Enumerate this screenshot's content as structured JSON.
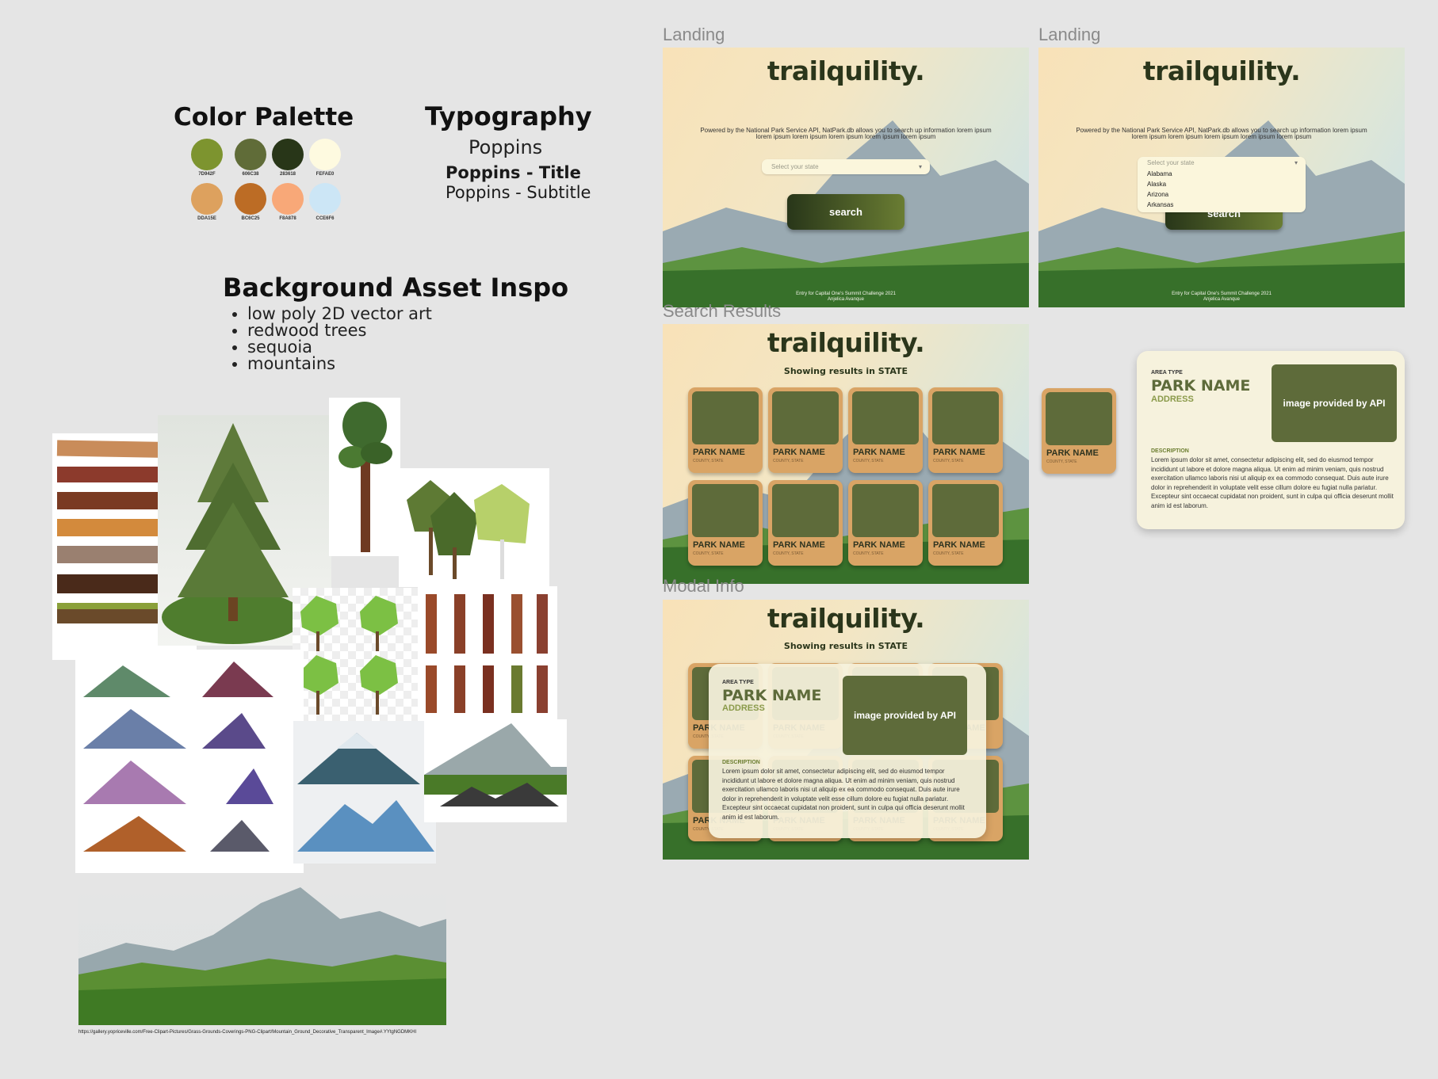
{
  "palette": {
    "title": "Color Palette",
    "colors": [
      {
        "hex": "#7D942F",
        "label": "7D942F"
      },
      {
        "hex": "#606C38",
        "label": "606C38"
      },
      {
        "hex": "#283618",
        "label": "283618"
      },
      {
        "hex": "#FEFAE0",
        "label": "FEFAE0"
      },
      {
        "hex": "#DDA15E",
        "label": "DDA15E"
      },
      {
        "hex": "#BC6C25",
        "label": "BC6C25"
      },
      {
        "hex": "#F8A878",
        "label": "F8A878"
      },
      {
        "hex": "#CCE6F6",
        "label": "CCE6F6"
      }
    ]
  },
  "typography": {
    "title": "Typography",
    "font": "Poppins",
    "sample_title": "Poppins - Title",
    "sample_subtitle": "Poppins - Subtitle"
  },
  "inspo": {
    "title": "Background Asset Inspo",
    "bullets": [
      "low poly 2D vector art",
      "redwood trees",
      "sequoia",
      "mountains"
    ],
    "source_url": "https://gallery.yopriceville.com/Free-Clipart-Pictures/Grass-Grounds-Coverings-PNG-Clipart/Mountain_Ground_Decorative_Transparent_Image#.YYtgNGDMKHI"
  },
  "frames": {
    "landing1_label": "Landing",
    "landing2_label": "Landing",
    "search_label": "Search Results",
    "modal_label": "Modal Info"
  },
  "app": {
    "logo": "trailquility.",
    "tagline": "Powered by the National Park Service API, NatPark.db allows you to search up information lorem ipsum lorem ipsum lorem ipsum lorem ipsum lorem ipsum lorem ipsum",
    "select_placeholder": "Select your state",
    "search_button": "search",
    "footer_line1": "Entry for Capital One's Summit Challenge 2021",
    "footer_line2": "Anjelica Avanque",
    "states": [
      "Alabama",
      "Alaska",
      "Arizona",
      "Arkansas"
    ],
    "showing_results": "Showing results in STATE",
    "card_park_name": "PARK NAME",
    "card_county_state": "COUNTY, STATE",
    "area_type": "AREA TYPE",
    "park_name": "PARK NAME",
    "address": "ADDRESS",
    "image_placeholder": "image provided by API",
    "description_label": "DESCRIPTION",
    "description": "Lorem ipsum dolor sit amet, consectetur adipiscing elit, sed do eiusmod tempor incididunt ut labore et dolore magna aliqua. Ut enim ad minim veniam, quis nostrud exercitation ullamco laboris nisi ut aliquip ex ea commodo consequat. Duis aute irure dolor in reprehenderit in voluptate velit esse cillum dolore eu fugiat nulla pariatur. Excepteur sint occaecat cupidatat non proident, sunt in culpa qui officia deserunt mollit anim id est laborum."
  }
}
